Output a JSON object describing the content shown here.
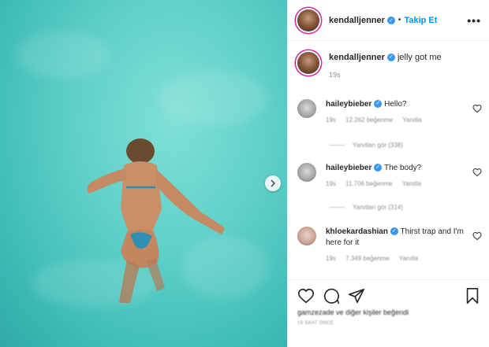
{
  "post": {
    "author": "kendalljenner",
    "follow_label": "Takip Et",
    "separator": "•",
    "more_label": "•••",
    "caption_text": "jelly got me",
    "caption_time": "19s"
  },
  "comments": [
    {
      "user": "haileybieber",
      "text": "Hello?",
      "time": "19s",
      "likes": "12.262 beğenme",
      "reply_label": "Yanıtla",
      "view_replies": "Yanıtları gör (338)"
    },
    {
      "user": "haileybieber",
      "text": "The body?",
      "time": "19s",
      "likes": "11.706 beğenme",
      "reply_label": "Yanıtla",
      "view_replies": "Yanıtları gör (314)"
    },
    {
      "user": "khloekardashian",
      "text": "Thirst trap and I'm here for it",
      "time": "19s",
      "likes": "7.349 beğenme",
      "reply_label": "Yanıtla"
    }
  ],
  "footer": {
    "liked_by": "gamzezade ve diğer kişiler beğendi",
    "time_ago": "19 SAAT ÖNCE"
  },
  "icons": {
    "like": "heart-icon",
    "comment": "comment-icon",
    "share": "share-icon",
    "save": "bookmark-icon",
    "next": "chevron-right-icon",
    "verified": "verified-badge-icon"
  },
  "colors": {
    "accent": "#0095f6",
    "verified": "#3897f0",
    "water": "#5fd0c8"
  }
}
